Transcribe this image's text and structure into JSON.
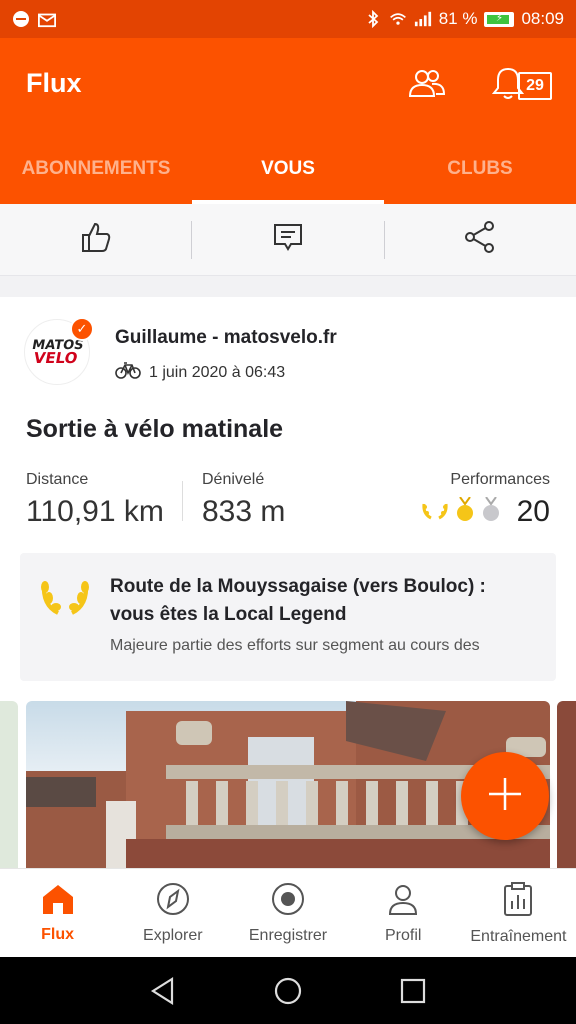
{
  "status_bar": {
    "battery_text": "81 %",
    "battery_level": 0.81,
    "time": "08:09"
  },
  "header": {
    "title": "Flux",
    "calendar_badge": "29"
  },
  "tabs": [
    {
      "label": "ABONNEMENTS",
      "active": false
    },
    {
      "label": "VOUS",
      "active": true
    },
    {
      "label": "CLUBS",
      "active": false
    }
  ],
  "activity": {
    "avatar_logo_line1": "MATOS",
    "avatar_logo_line2": "VELO",
    "athlete_name": "Guillaume - matosvelo.fr",
    "date": "1 juin 2020 à 06:43",
    "title": "Sortie à vélo matinale",
    "stats": {
      "distance_label": "Distance",
      "distance_value": "110,91 km",
      "elevation_label": "Dénivelé",
      "elevation_value": "833 m",
      "performances_label": "Performances",
      "performances_value": "20"
    },
    "local_legend": {
      "title": "Route de la Mouyssagaise (vers Bouloc) : vous êtes la Local Legend",
      "description": "Majeure partie des efforts sur segment au cours des"
    }
  },
  "bottom_nav": [
    {
      "label": "Flux",
      "icon": "home-icon",
      "active": true
    },
    {
      "label": "Explorer",
      "icon": "compass-icon",
      "active": false
    },
    {
      "label": "Enregistrer",
      "icon": "record-icon",
      "active": false
    },
    {
      "label": "Profil",
      "icon": "profile-icon",
      "active": false
    },
    {
      "label": "Entraînement",
      "icon": "clipboard-chart-icon",
      "active": false
    }
  ],
  "colors": {
    "brand": "#fc5200",
    "status_bar": "#e34402"
  }
}
